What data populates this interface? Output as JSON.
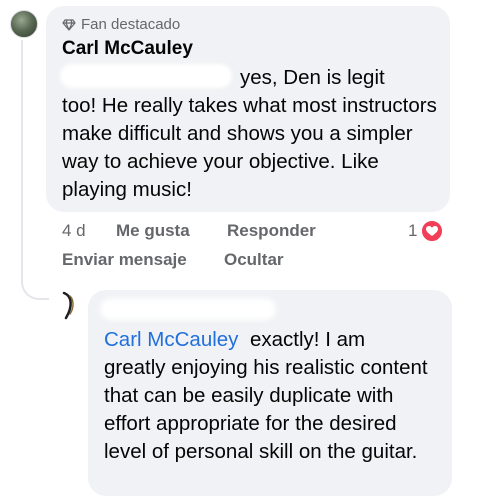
{
  "comment": {
    "badge": "Fan destacado",
    "author": "Carl McCauley",
    "text_line1": "yes, Den is legit",
    "text_rest": "too!  He really takes what most instructors make difficult and shows you a simpler way to achieve your objective.  Like playing music!",
    "actions": {
      "time": "4 d",
      "like": "Me gusta",
      "reply": "Responder",
      "send_message": "Enviar mensaje",
      "hide": "Ocultar"
    },
    "reaction": {
      "icon": "heart-icon",
      "count": "1",
      "color": "#f33e58"
    }
  },
  "reply": {
    "mention": "Carl McCauley",
    "text_line1": "exactly! I am",
    "text_rest": "greatly enjoying his realistic content that can be easily duplicate with effort appropriate for the desired level of personal skill on the guitar.",
    "mention_color": "#216fdb"
  }
}
